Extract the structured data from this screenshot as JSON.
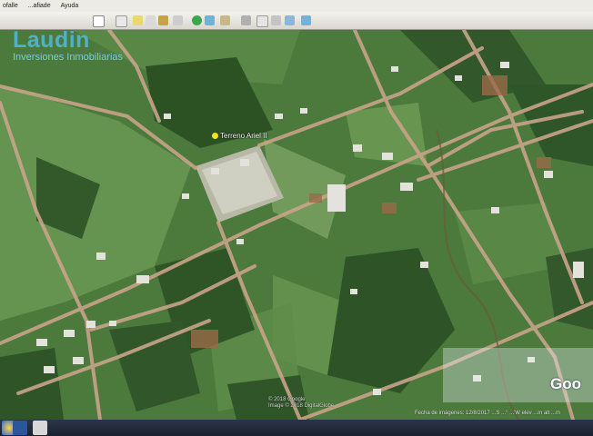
{
  "menubar": {
    "items": [
      "ofalle",
      "...afiade",
      "Ayuda"
    ]
  },
  "toolbar": {
    "icon_names": [
      "hide-sidebar-icon",
      "placemark-icon",
      "polygon-icon",
      "path-icon",
      "image-overlay-icon",
      "record-tour-icon",
      "historical-imagery-icon",
      "sun-icon",
      "planets-icon",
      "ruler-icon",
      "email-icon",
      "print-icon",
      "save-image-icon",
      "view-in-maps-icon"
    ]
  },
  "watermark": {
    "brand": "Laudin",
    "subtitle": "Inversiones Inmobiliarias"
  },
  "placemark": {
    "label": "Terreno Ariel II"
  },
  "copyright": {
    "line1": "© 2018 Google",
    "line2": "Image © 2018 DigitalGlobe"
  },
  "status": {
    "text": "Fecha de imágenes: 12/8/2017   ...S ...° ...'W  elev ...m  alt ...m"
  },
  "google_logo": {
    "text": "Goo"
  },
  "taskbar": {
    "icon_names": [
      "windows-start-icon",
      "word-icon",
      "pdf-icon"
    ]
  }
}
